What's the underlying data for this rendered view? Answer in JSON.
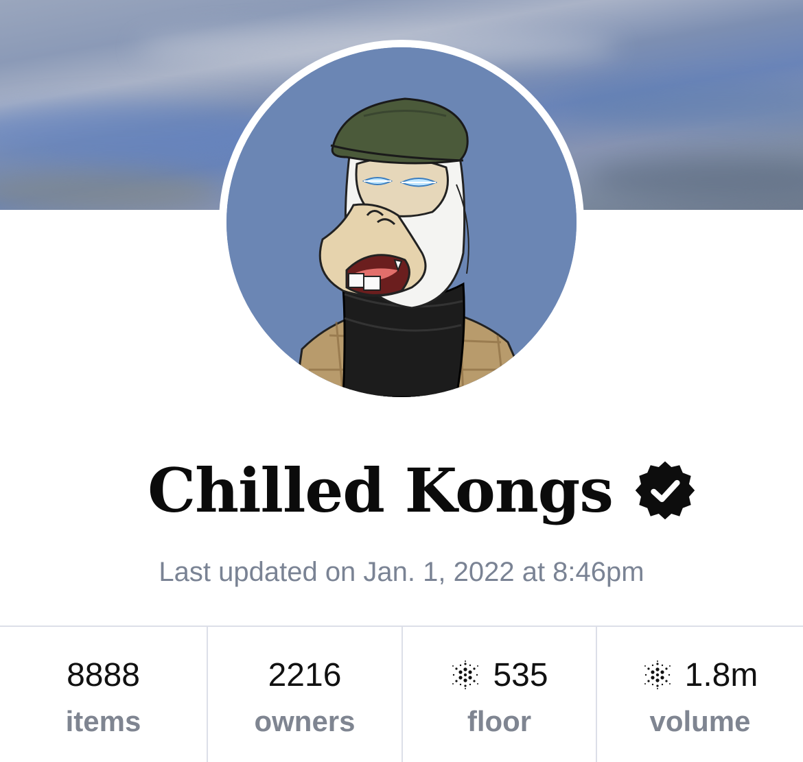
{
  "collection": {
    "name": "Chilled Kongs",
    "last_updated": "Last updated on Jan. 1, 2022 at 8:46pm"
  },
  "stats": [
    {
      "value": "8888",
      "label": "items",
      "icon": null
    },
    {
      "value": "2216",
      "label": "owners",
      "icon": null
    },
    {
      "value": "535",
      "label": "floor",
      "icon": "cardano-icon"
    },
    {
      "value": "1.8m",
      "label": "volume",
      "icon": "cardano-icon"
    }
  ],
  "colors": {
    "title": "#0b0b0b",
    "muted": "#7a8394",
    "divider": "#dcdfe8",
    "avatar_bg": "#6b86b4"
  }
}
